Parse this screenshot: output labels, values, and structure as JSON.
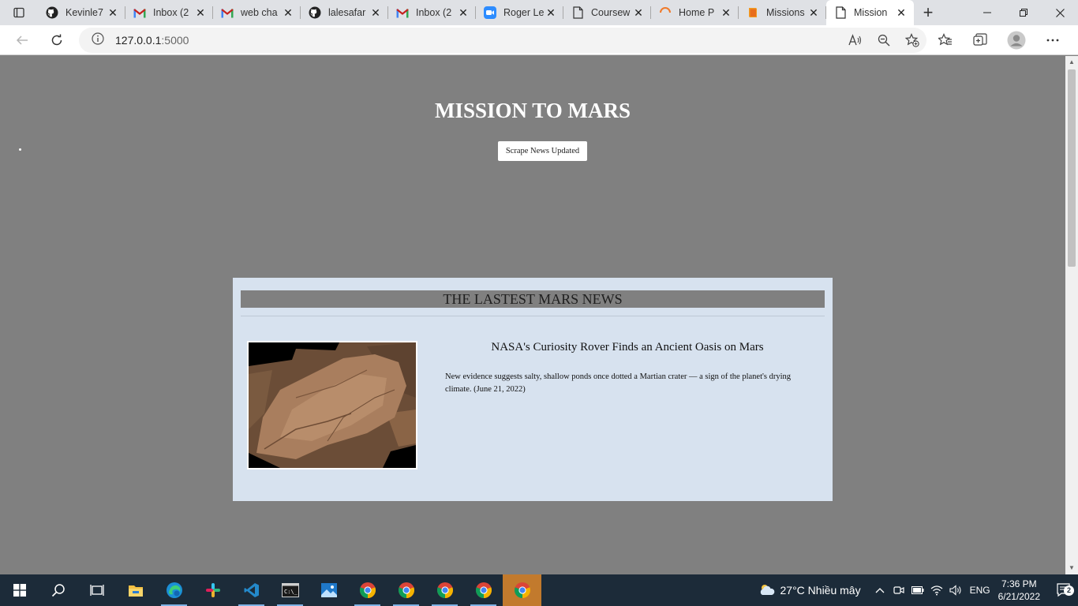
{
  "browser": {
    "tabs": [
      {
        "title": "Kevinle7",
        "icon": "github-icon"
      },
      {
        "title": "Inbox (2",
        "icon": "gmail-icon"
      },
      {
        "title": "web cha",
        "icon": "gmail-icon"
      },
      {
        "title": "lalesafar",
        "icon": "github-icon"
      },
      {
        "title": "Inbox (2",
        "icon": "gmail-icon"
      },
      {
        "title": "Roger Le",
        "icon": "zoom-icon"
      },
      {
        "title": "Coursew",
        "icon": "page-icon"
      },
      {
        "title": "Home P",
        "icon": "spinner-icon"
      },
      {
        "title": "Missions",
        "icon": "book-icon"
      },
      {
        "title": "Mission",
        "icon": "page-icon",
        "active": true
      }
    ],
    "address": {
      "host": "127.0.0.1",
      "port": ":5000"
    }
  },
  "page": {
    "title": "MISSION TO MARS",
    "scrape_button": "Scrape News Updated",
    "news": {
      "heading": "THE LASTEST MARS NEWS",
      "article_title": "NASA's Curiosity Rover Finds an Ancient Oasis on Mars",
      "article_body": "New evidence suggests salty, shallow ponds once dotted a Martian crater — a sign of the planet's drying climate. (June 21, 2022)"
    }
  },
  "taskbar": {
    "apps": [
      "start-icon",
      "search-icon",
      "task-view-icon",
      "file-explorer-icon",
      "edge-icon",
      "slack-icon",
      "vscode-icon",
      "terminal-icon",
      "photos-icon",
      "chrome-icon",
      "chrome-icon",
      "chrome-icon",
      "chrome-icon",
      "chrome-icon"
    ],
    "weather": "27°C  Nhiều mây",
    "language": "ENG",
    "time": "7:36 PM",
    "date": "6/21/2022",
    "notifications": "2"
  },
  "colors": {
    "page_bg": "#808080",
    "panel_bg": "#d7e2ef",
    "heading_bar": "#808080",
    "taskbar_bg": "#1c2b39"
  }
}
